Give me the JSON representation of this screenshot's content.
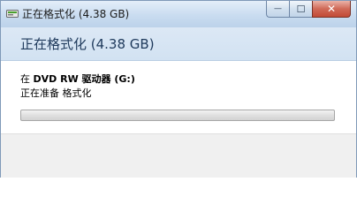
{
  "window": {
    "title": "正在格式化 (4.38 GB)",
    "caption_buttons": {
      "minimize_glyph": "—",
      "maximize_glyph": "☐",
      "close_glyph": "✕"
    }
  },
  "dialog": {
    "heading": "正在格式化 (4.38 GB)",
    "drive_prefix": "在",
    "drive_name": "DVD RW 驱动器 (G:)",
    "status": "正在准备 格式化",
    "progress": 0
  },
  "colors": {
    "heading_text": "#1e395b",
    "titlebar": "#c9dcf0",
    "progress_fill": "#35b20e"
  },
  "icons": {
    "app": "drive-format-icon"
  }
}
